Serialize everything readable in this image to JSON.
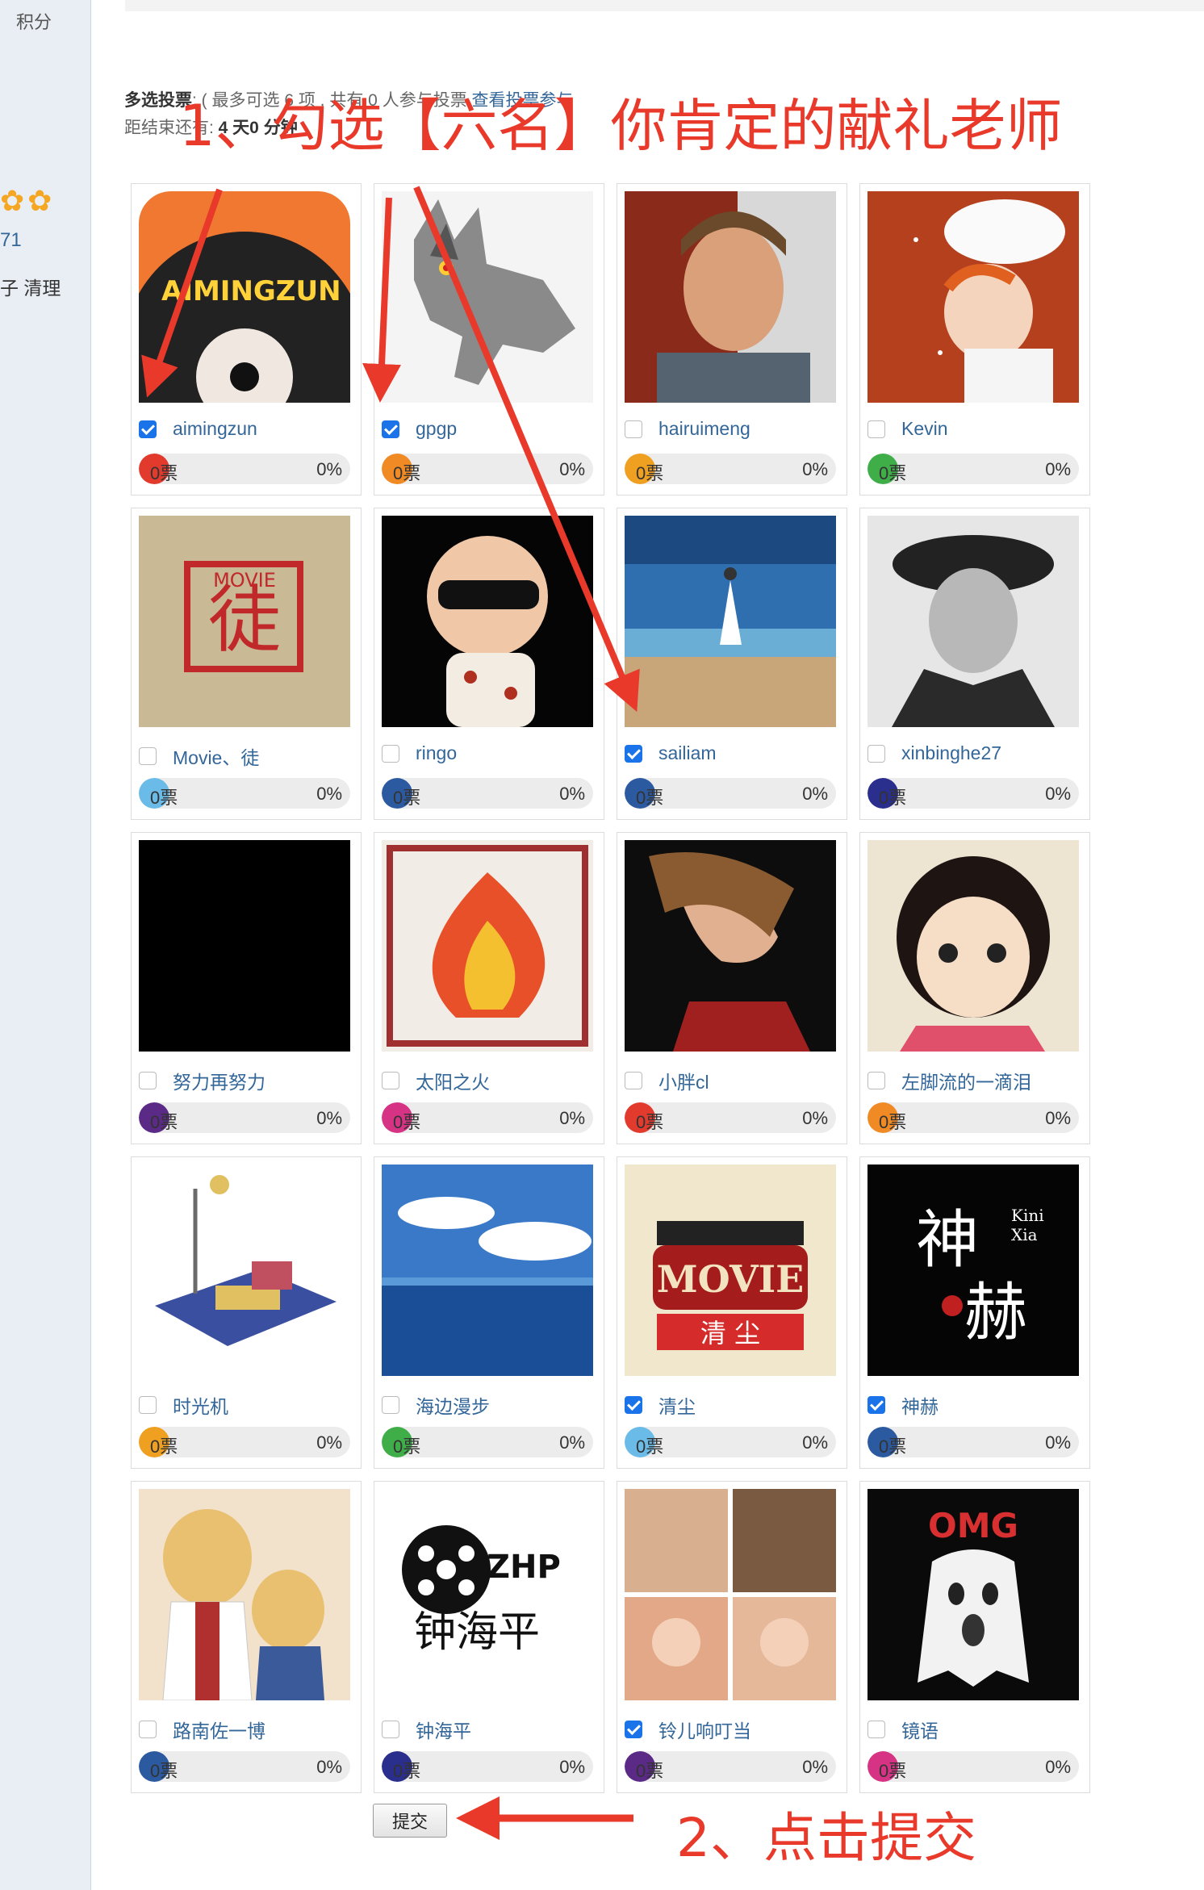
{
  "sidebar": {
    "top_label": "积分",
    "number": "71",
    "links": "子 清理",
    "stars": "✿✿"
  },
  "poll": {
    "type_label": "多选投票",
    "rule_text": ": ( 最多可选 6 项 , 共有 0 人参与投票 ",
    "view_link": "查看投票参与",
    "countdown_label": "距结束还有: ",
    "countdown_value": "4 天0 分钟"
  },
  "annotations": {
    "step1": "1、勾选【六名】你肯定的献礼老师",
    "step2": "2、点击提交"
  },
  "submit_label": "提交",
  "options": [
    {
      "name": "aimingzun",
      "checked": true,
      "votes": "0票",
      "percent": "0%",
      "color": "#e23b2e",
      "art": "record"
    },
    {
      "name": "gpgp",
      "checked": true,
      "votes": "0票",
      "percent": "0%",
      "color": "#f08a24",
      "art": "wolf"
    },
    {
      "name": "hairuimeng",
      "checked": false,
      "votes": "0票",
      "percent": "0%",
      "color": "#f0a020",
      "art": "pilot"
    },
    {
      "name": "Kevin",
      "checked": false,
      "votes": "0票",
      "percent": "0%",
      "color": "#3fae49",
      "art": "anime-hat"
    },
    {
      "name": "Movie、徒",
      "checked": false,
      "votes": "0票",
      "percent": "0%",
      "color": "#6bbbe8",
      "art": "movie-stamp"
    },
    {
      "name": "ringo",
      "checked": false,
      "votes": "0票",
      "percent": "0%",
      "color": "#2c5aa0",
      "art": "baby"
    },
    {
      "name": "sailiam",
      "checked": true,
      "votes": "0票",
      "percent": "0%",
      "color": "#2c5aa0",
      "art": "beach"
    },
    {
      "name": "xinbinghe27",
      "checked": false,
      "votes": "0票",
      "percent": "0%",
      "color": "#2a2e8c",
      "art": "officer"
    },
    {
      "name": "努力再努力",
      "checked": false,
      "votes": "0票",
      "percent": "0%",
      "color": "#5b2a86",
      "art": "black"
    },
    {
      "name": "太阳之火",
      "checked": false,
      "votes": "0票",
      "percent": "0%",
      "color": "#d63384",
      "art": "fire"
    },
    {
      "name": "小胖cl",
      "checked": false,
      "votes": "0票",
      "percent": "0%",
      "color": "#e23b2e",
      "art": "singer"
    },
    {
      "name": "左脚流的一滴泪",
      "checked": false,
      "votes": "0票",
      "percent": "0%",
      "color": "#f08a24",
      "art": "girl"
    },
    {
      "name": "时光机",
      "checked": false,
      "votes": "0票",
      "percent": "0%",
      "color": "#f0a020",
      "art": "timemachine"
    },
    {
      "name": "海边漫步",
      "checked": false,
      "votes": "0票",
      "percent": "0%",
      "color": "#3fae49",
      "art": "sea"
    },
    {
      "name": "清尘",
      "checked": true,
      "votes": "0票",
      "percent": "0%",
      "color": "#6bbbe8",
      "art": "movie-clap"
    },
    {
      "name": "神赫",
      "checked": true,
      "votes": "0票",
      "percent": "0%",
      "color": "#2c5aa0",
      "art": "shenhe"
    },
    {
      "name": "路南佐一博",
      "checked": false,
      "votes": "0票",
      "percent": "0%",
      "color": "#2c5aa0",
      "art": "conan"
    },
    {
      "name": "钟海平",
      "checked": false,
      "votes": "0票",
      "percent": "0%",
      "color": "#2a2e8c",
      "art": "zhp"
    },
    {
      "name": "铃儿响叮当",
      "checked": true,
      "votes": "0票",
      "percent": "0%",
      "color": "#5b2a86",
      "art": "collage"
    },
    {
      "name": "镜语",
      "checked": false,
      "votes": "0票",
      "percent": "0%",
      "color": "#d63384",
      "art": "omg"
    }
  ]
}
